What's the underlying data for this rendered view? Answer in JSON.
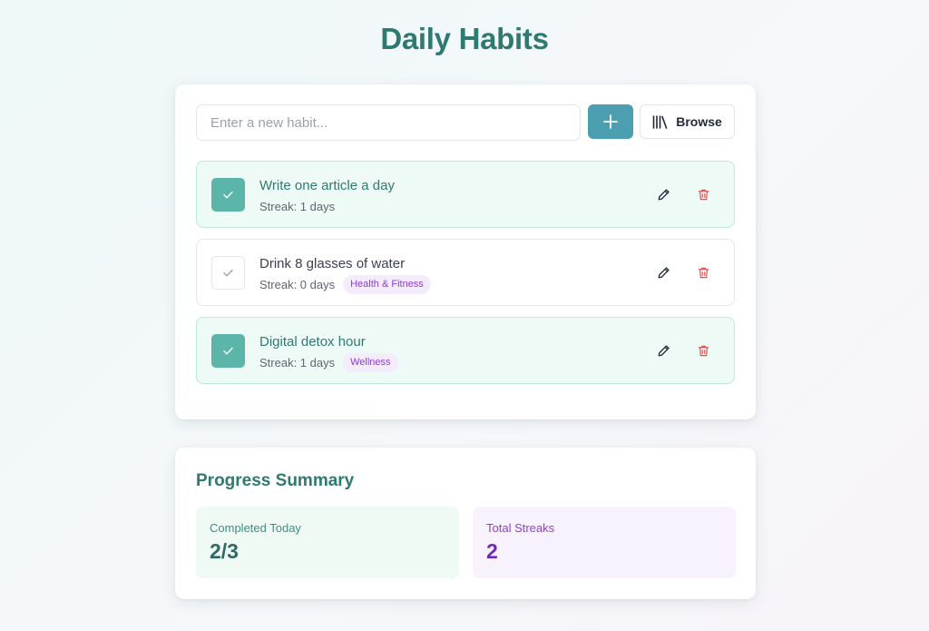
{
  "title": "Daily Habits",
  "input": {
    "placeholder": "Enter a new habit...",
    "value": ""
  },
  "buttons": {
    "add_icon": "plus-icon",
    "browse_label": "Browse",
    "browse_icon": "library-icon"
  },
  "habits": [
    {
      "title": "Write one article a day",
      "streak_text": "Streak: 1 days",
      "category": "",
      "completed": true
    },
    {
      "title": "Drink 8 glasses of water",
      "streak_text": "Streak: 0 days",
      "category": "Health & Fitness",
      "completed": false
    },
    {
      "title": "Digital detox hour",
      "streak_text": "Streak: 1 days",
      "category": "Wellness",
      "completed": true
    }
  ],
  "summary": {
    "title": "Progress Summary",
    "completed_label": "Completed Today",
    "completed_value": "2/3",
    "streaks_label": "Total Streaks",
    "streaks_value": "2"
  },
  "colors": {
    "accent": "#2f7a70",
    "add_button": "#4b9fb0",
    "checked": "#5bb5a8",
    "delete": "#e05252",
    "tag_text": "#8a3fd0"
  }
}
